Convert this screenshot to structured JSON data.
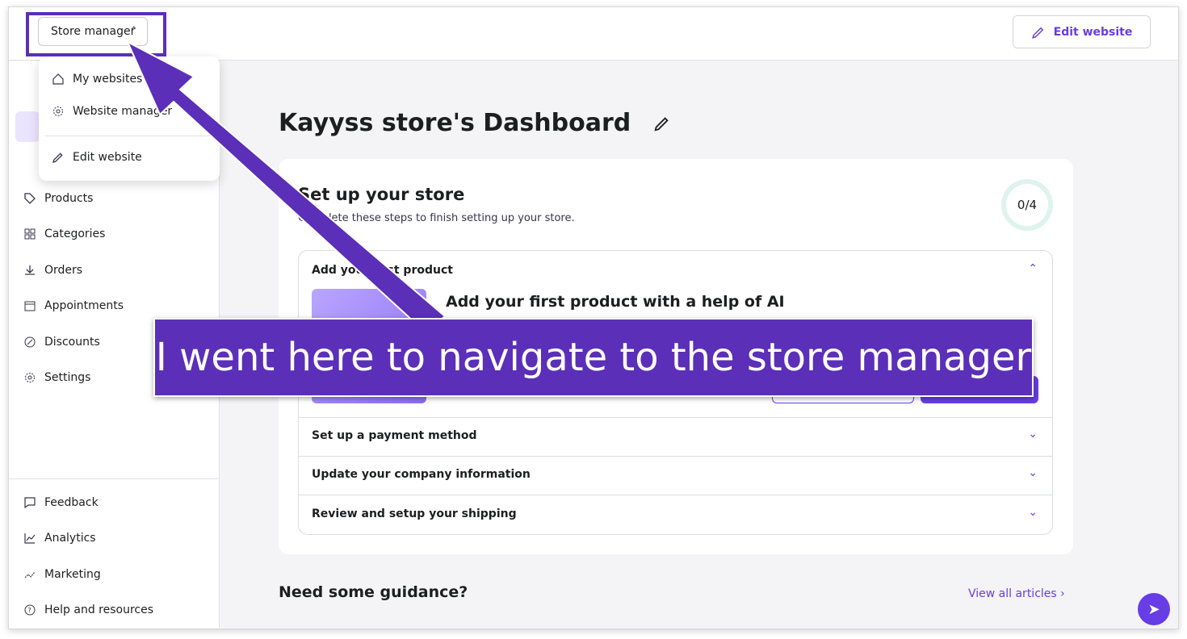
{
  "topbar": {
    "store_manager_label": "Store manager",
    "edit_website_label": "Edit website"
  },
  "dropdown": {
    "items": [
      {
        "label": "My websites",
        "icon": "home-icon"
      },
      {
        "label": "Website manager",
        "icon": "gear-icon"
      },
      {
        "label": "Edit website",
        "icon": "pencil-icon"
      }
    ]
  },
  "sidebar": {
    "items": [
      {
        "label": "Products",
        "icon": "tag-icon"
      },
      {
        "label": "Categories",
        "icon": "grid-icon"
      },
      {
        "label": "Orders",
        "icon": "download-icon"
      },
      {
        "label": "Appointments",
        "icon": "calendar-icon"
      },
      {
        "label": "Discounts",
        "icon": "discount-icon"
      },
      {
        "label": "Settings",
        "icon": "gear-icon"
      }
    ],
    "bottom_items": [
      {
        "label": "Feedback",
        "icon": "chat-icon"
      },
      {
        "label": "Analytics",
        "icon": "chart-icon"
      },
      {
        "label": "Marketing",
        "icon": "trend-icon"
      },
      {
        "label": "Help and resources",
        "icon": "help-icon"
      }
    ]
  },
  "main": {
    "title": "Kayyss store's Dashboard",
    "setup": {
      "title": "Set up your store",
      "subtitle": "Complete these steps to finish setting up your store.",
      "progress": "0/4",
      "steps": [
        {
          "label": "Add your first product",
          "expanded": true
        },
        {
          "label": "Set up a payment method",
          "expanded": false
        },
        {
          "label": "Update your company information",
          "expanded": false
        },
        {
          "label": "Review and setup your shipping",
          "expanded": false
        }
      ],
      "ai_title": "Add your first product with a help of AI"
    },
    "guidance_title": "Need some guidance?",
    "view_all_label": "View all articles"
  },
  "annotation": {
    "text": "I went here to navigate to the store manager"
  },
  "colors": {
    "accent": "#673de6",
    "annotation": "#5b2fb8"
  }
}
